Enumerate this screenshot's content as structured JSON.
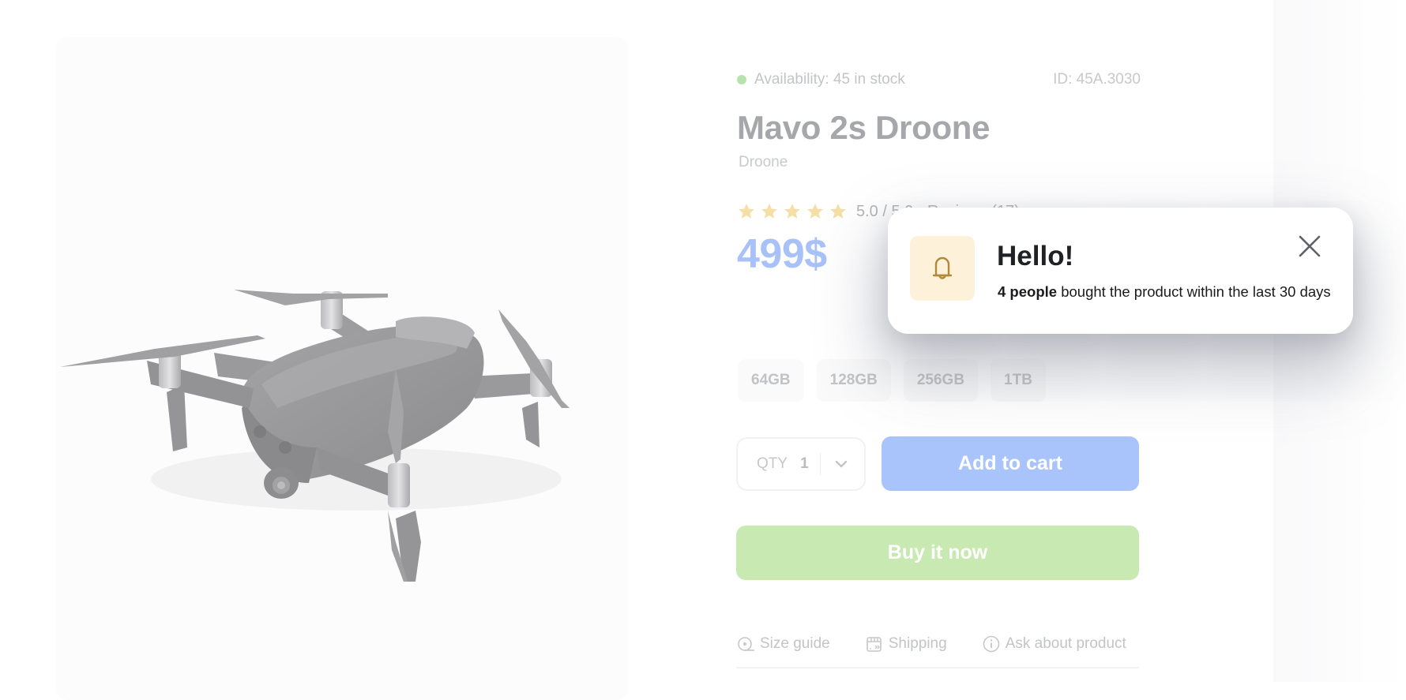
{
  "product_image": {
    "alt": "Mavo 2s Droone product photo",
    "icon": "drone-photo"
  },
  "product": {
    "availability": "Availability: 45 in stock",
    "availability_color": "#b6e3ad",
    "id_label": "ID: 45A.3030",
    "title": "Mavo 2s Droone",
    "category": "Droone",
    "rating": {
      "stars_filled": 5,
      "stars_total": 5,
      "text": "5.0 / 5.0 · Reviews (17)",
      "star_color": "#f6dfa6"
    },
    "price": "499$",
    "price_color": "#a8c2f9"
  },
  "storage_options": [
    {
      "label": "64GB"
    },
    {
      "label": "128GB"
    },
    {
      "label": "256GB"
    },
    {
      "label": "1TB"
    }
  ],
  "quantity": {
    "label": "QTY",
    "value": "1",
    "icon": "chevron-down-icon"
  },
  "actions": {
    "add_to_cart": "Add to cart",
    "add_to_cart_color": "#a9c4fa",
    "buy_now": "Buy it now",
    "buy_now_color": "#c9e9b3"
  },
  "links": [
    {
      "label": "Size guide",
      "icon": "tape-measure-icon"
    },
    {
      "label": "Shipping",
      "icon": "shipping-icon"
    },
    {
      "label": "Ask about product",
      "icon": "info-icon"
    }
  ],
  "notification": {
    "icon": "bell-icon",
    "title": "Hello!",
    "message_bold": "4 people",
    "message_rest": " bought the product within the last 30 days",
    "close_icon": "close-icon",
    "accent_bg": "#fdf1da",
    "accent_color": "#b08a3a"
  }
}
